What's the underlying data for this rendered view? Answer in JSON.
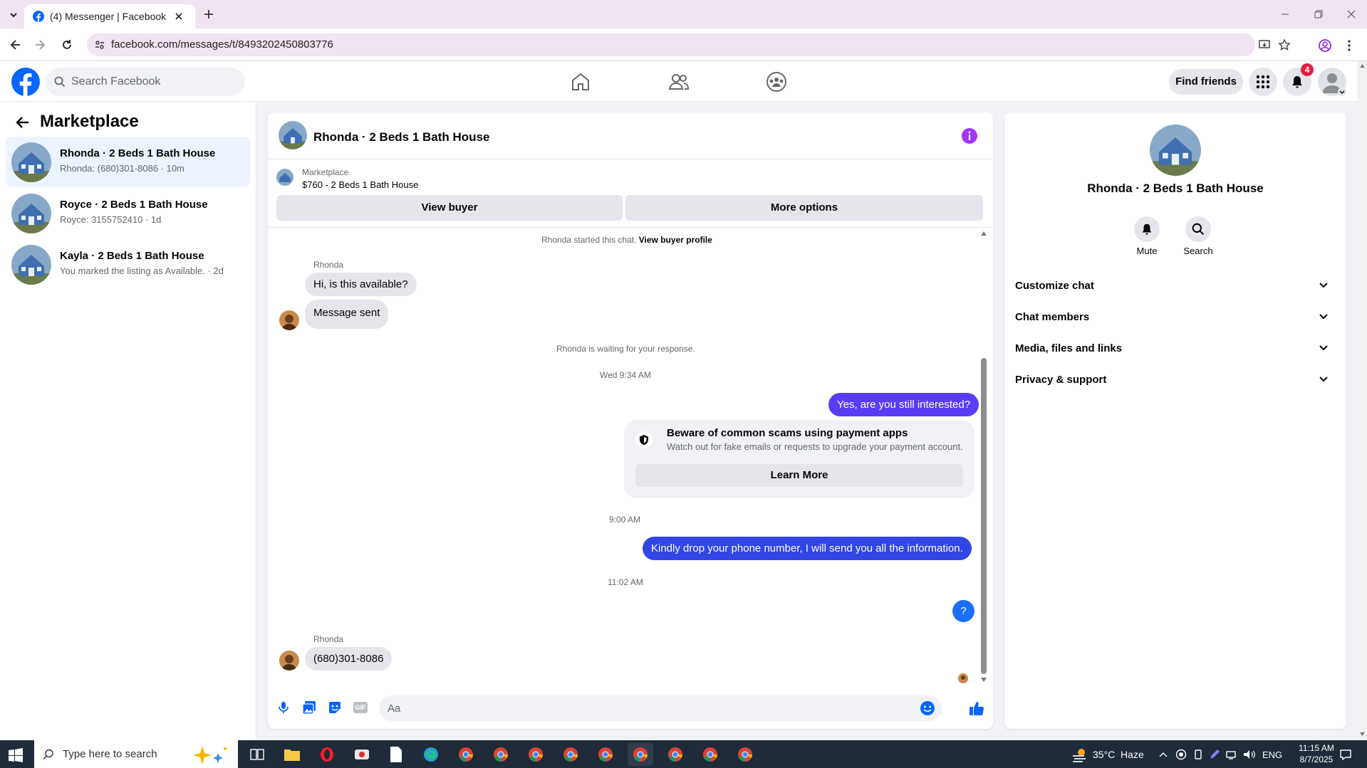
{
  "browser": {
    "tab_title": "(4) Messenger | Facebook",
    "url": "facebook.com/messages/t/8493202450803776"
  },
  "header": {
    "search_placeholder": "Search Facebook",
    "find_friends": "Find friends",
    "notification_count": "4"
  },
  "sidebar": {
    "title": "Marketplace",
    "conversations": [
      {
        "title": "Rhonda · 2 Beds 1 Bath House",
        "snippet": "Rhonda: (680)301-8086 · 10m"
      },
      {
        "title": "Royce · 2 Beds 1 Bath House",
        "snippet": "Royce: 3155752410 · 1d"
      },
      {
        "title": "Kayla · 2 Beds 1 Bath House",
        "snippet": "You marked the listing as Available. · 2d"
      }
    ]
  },
  "chat": {
    "title": "Rhonda · 2 Beds 1 Bath House",
    "listing_source": "Marketplace",
    "listing_price_title": "$760 - 2 Beds 1 Bath House",
    "view_buyer": "View buyer",
    "more_options": "More options",
    "started_text": "Rhonda started this chat.",
    "view_buyer_profile": "View buyer profile",
    "sender_name_1": "Rhonda",
    "msg_1": "Hi, is this available?",
    "msg_2": "Message sent",
    "waiting_text": "Rhonda is waiting for your response.",
    "time_1": "Wed 9:34 AM",
    "msg_out_1": "Yes, are you still interested?",
    "scam_title": "Beware of common scams using payment apps",
    "scam_text": "Watch out for fake emails or requests to upgrade your payment account.",
    "learn_more": "Learn More",
    "time_2": "9:00 AM",
    "msg_out_2": "Kindly drop your phone number, I will send you all the information.",
    "time_3": "11:02 AM",
    "msg_out_3": "?",
    "sender_name_2": "Rhonda",
    "msg_3": "(680)301-8086",
    "composer_placeholder": "Aa"
  },
  "info_panel": {
    "title": "Rhonda · 2 Beds 1 Bath House",
    "mute": "Mute",
    "search": "Search",
    "sections": [
      "Customize chat",
      "Chat members",
      "Media, files and links",
      "Privacy & support"
    ]
  },
  "taskbar": {
    "search_placeholder": "Type here to search",
    "weather": "35°C  Haze",
    "lang": "ENG",
    "time": "11:15 AM",
    "date": "8/7/2025"
  },
  "colors": {
    "fb_blue": "#0866ff",
    "messenger_purple": "#5b3cf5",
    "info_purple": "#a033ff",
    "badge_red": "#e41e3f"
  }
}
